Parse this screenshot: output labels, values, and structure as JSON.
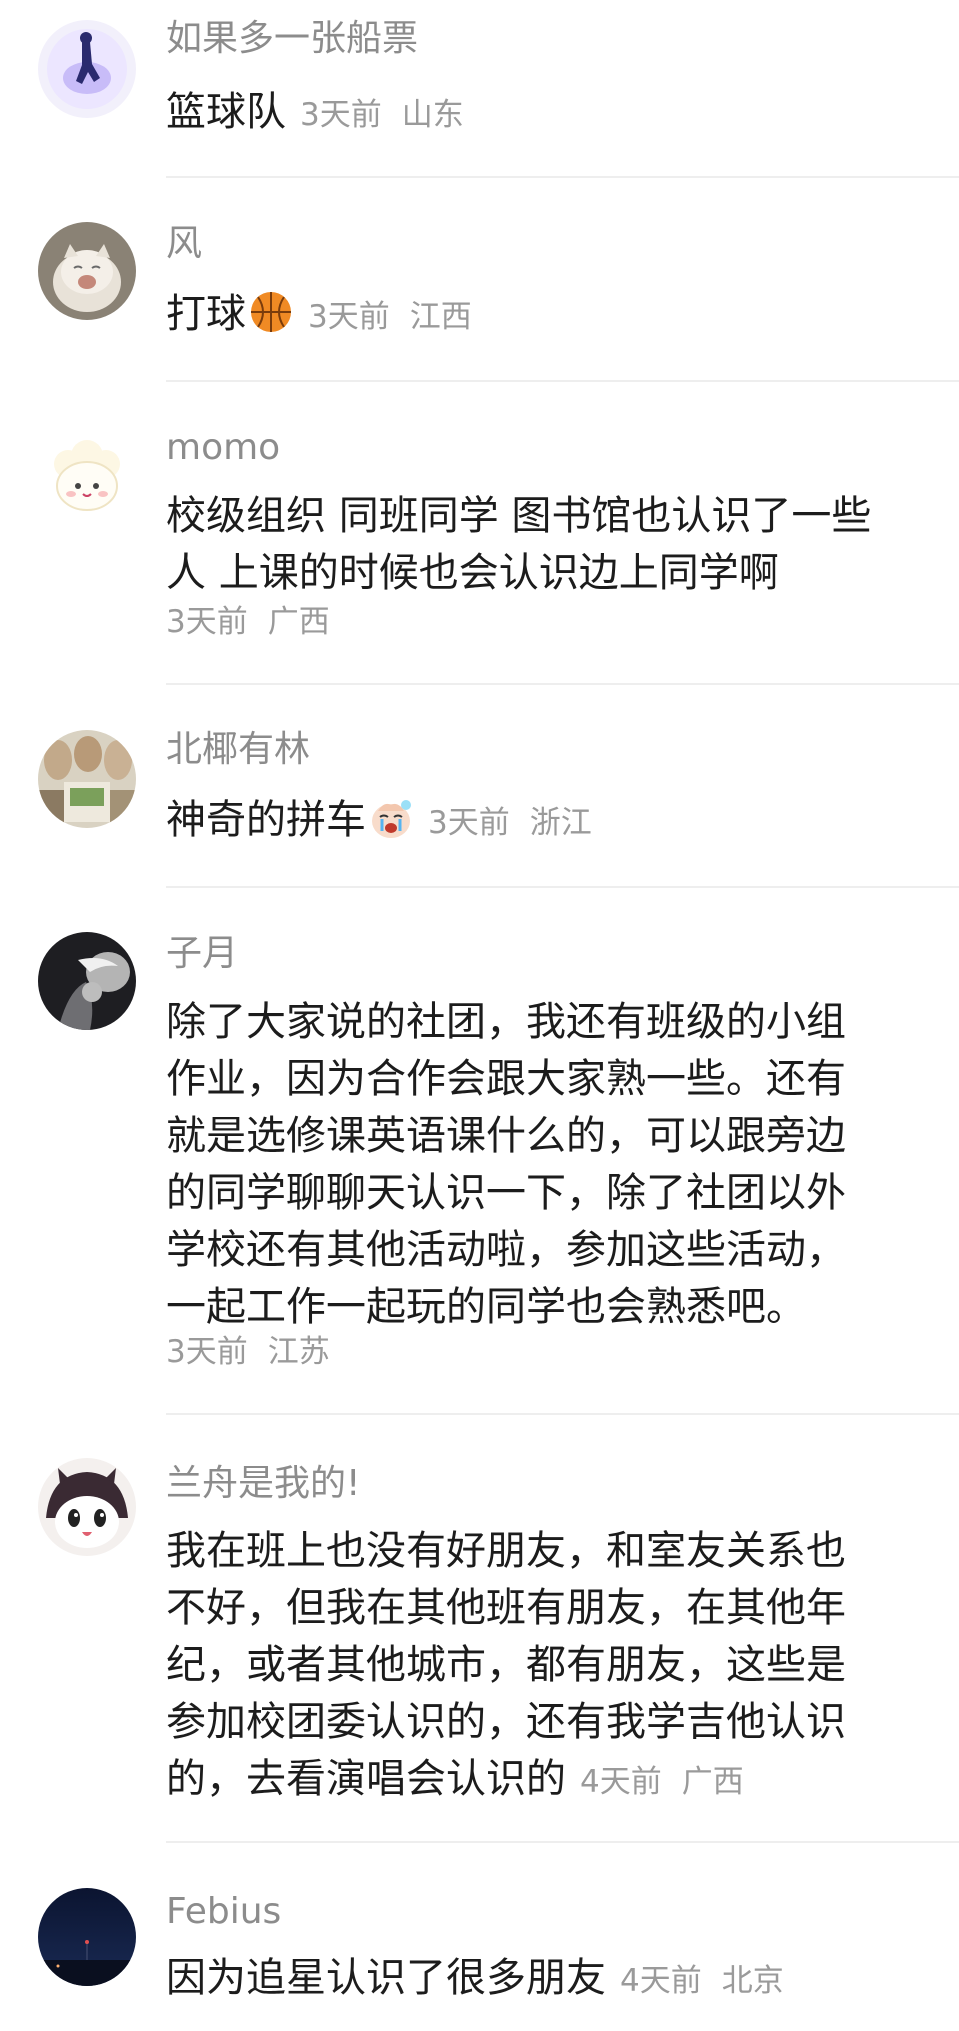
{
  "comments": [
    {
      "username": "如果多一张船票",
      "text": "篮球队",
      "time": "3天前",
      "location": "山东",
      "avatar_icon": "silhouette-avatar-icon"
    },
    {
      "username": "风",
      "text": "打球",
      "emoji": "basketball-icon",
      "time": "3天前",
      "location": "江西",
      "avatar_icon": "cat-avatar-icon"
    },
    {
      "username": "momo",
      "text_lines": [
        "校级组织 同班同学 图书馆也认识了一些",
        "人 上课的时候也会认识边上同学啊"
      ],
      "time": "3天前",
      "location": "广西",
      "avatar_icon": "sheep-avatar-icon"
    },
    {
      "username": "北椰有林",
      "text": "神奇的拼车",
      "emoji": "crying-face-icon",
      "time": "3天前",
      "location": "浙江",
      "avatar_icon": "group-photo-avatar-icon"
    },
    {
      "username": "子月",
      "text_lines": [
        "除了大家说的社团，我还有班级的小组",
        "作业，因为合作会跟大家熟一些。还有",
        "就是选修课英语课什么的，可以跟旁边",
        "的同学聊聊天认识一下，除了社团以外",
        "学校还有其他活动啦，参加这些活动，",
        "一起工作一起玩的同学也会熟悉吧。"
      ],
      "time": "3天前",
      "location": "江苏",
      "avatar_icon": "dark-photo-avatar-icon"
    },
    {
      "username": "兰舟是我的!",
      "text_lines": [
        "我在班上也没有好朋友，和室友关系也",
        "不好，但我在其他班有朋友，在其他年",
        "纪，或者其他城市，都有朋友，这些是",
        "参加校团委认识的，还有我学吉他认识",
        "的，去看演唱会认识的"
      ],
      "time": "4天前",
      "location": "广西",
      "avatar_icon": "cartoon-avatar-icon"
    },
    {
      "username": "Febius",
      "text": "因为追星认识了很多朋友",
      "time": "4天前",
      "location": "北京",
      "avatar_icon": "night-sky-avatar-icon"
    }
  ]
}
